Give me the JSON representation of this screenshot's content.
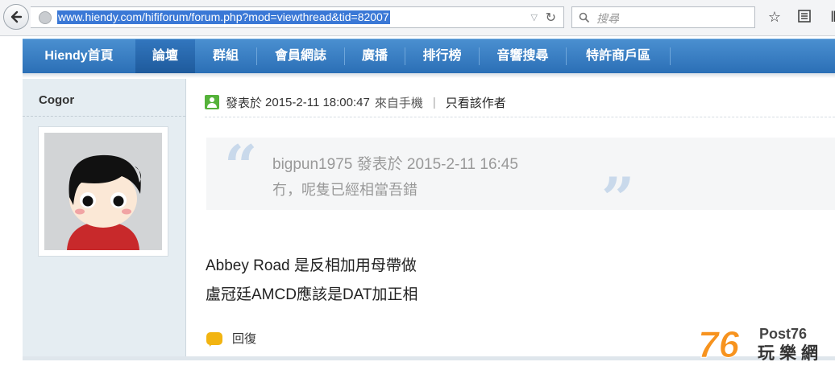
{
  "browser": {
    "url": "www.hiendy.com/hififorum/forum.php?mod=viewthread&tid=82007",
    "search_placeholder": "搜尋"
  },
  "nav": {
    "items": [
      {
        "label": "Hiendy首頁"
      },
      {
        "label": "論壇",
        "active": true
      },
      {
        "label": "群組"
      },
      {
        "label": "會員網誌"
      },
      {
        "label": "廣播"
      },
      {
        "label": "排行榜"
      },
      {
        "label": "音響搜尋"
      },
      {
        "label": "特許商戶區"
      }
    ]
  },
  "author": {
    "username": "Cogor"
  },
  "post": {
    "posted_label": "發表於",
    "posted_time": "2015-2-11 18:00:47",
    "source": "來自手機",
    "separator": "|",
    "only_author": "只看該作者",
    "quote": {
      "header": "bigpun1975 發表於 2015-2-11 16:45",
      "text": "冇，呢隻已經相當吾錯"
    },
    "body": [
      "Abbey Road 是反相加用母帶做",
      "盧冠廷AMCD應該是DAT加正相"
    ],
    "reply_label": "回復"
  },
  "watermark": {
    "number": "76",
    "brand": "Post76",
    "subtitle": "玩樂網"
  },
  "colors": {
    "nav_bg": "#2f77c0",
    "url_highlight": "#3a78d6",
    "sidebar_bg": "#e5edf2",
    "logo_orange": "#f7931e"
  }
}
